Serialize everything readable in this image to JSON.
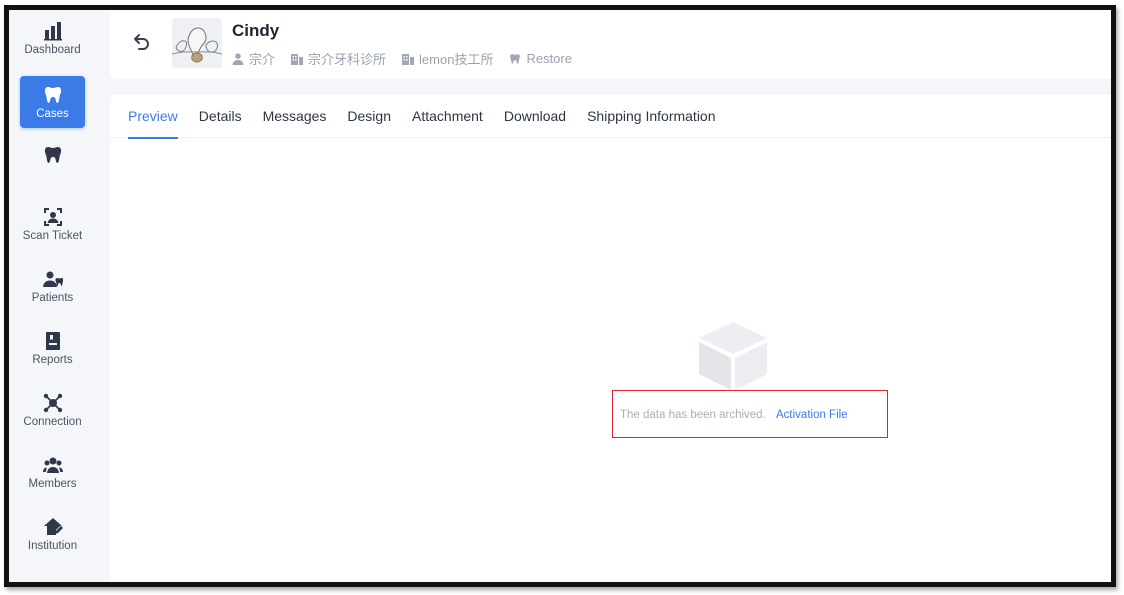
{
  "sidebar": {
    "items": [
      {
        "label": "Dashboard",
        "icon": "bar-chart-icon"
      },
      {
        "label": "Cases",
        "icon": "tooth-icon",
        "active": true
      },
      {
        "label": "",
        "icon": "tooth-icon"
      },
      {
        "label": "Scan Ticket",
        "icon": "scan-user-icon"
      },
      {
        "label": "Patients",
        "icon": "patient-tooth-icon"
      },
      {
        "label": "Reports",
        "icon": "report-book-icon"
      },
      {
        "label": "Connection",
        "icon": "connection-hub-icon"
      },
      {
        "label": "Members",
        "icon": "members-group-icon"
      },
      {
        "label": "Institution",
        "icon": "institution-house-icon"
      }
    ]
  },
  "header": {
    "case_name": "Cindy",
    "doctor": "宗介",
    "clinic": "宗介牙科诊所",
    "lab": "lemon技工所",
    "restore": "Restore"
  },
  "tabs": [
    {
      "label": "Preview",
      "active": true
    },
    {
      "label": "Details"
    },
    {
      "label": "Messages"
    },
    {
      "label": "Design"
    },
    {
      "label": "Attachment"
    },
    {
      "label": "Download"
    },
    {
      "label": "Shipping Information"
    }
  ],
  "empty_state": {
    "message": "The data has been archived.",
    "action": "Activation File"
  },
  "colors": {
    "accent": "#3b7be8",
    "highlight": "#e0262b",
    "sidebar_bg": "#f4f6f9"
  }
}
